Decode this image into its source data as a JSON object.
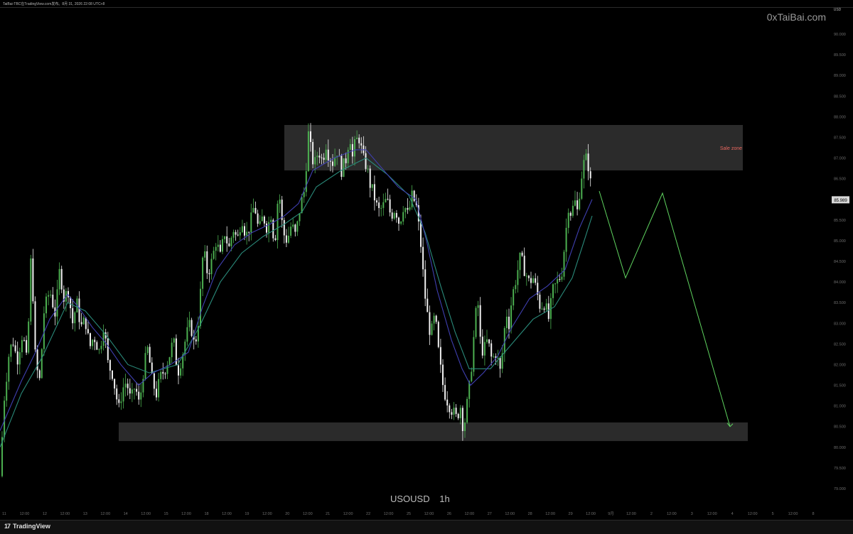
{
  "header": {
    "author_line": "TaiBai-TBC在TradingView.com发布。8月 31, 2026 22:08 UTC+8"
  },
  "watermark": "0xTaiBai.com",
  "symbol": "USOUSD",
  "interval": "1h",
  "footer": {
    "brand": "TradingView",
    "brand_mark": "17"
  },
  "colors": {
    "background": "#000000",
    "candle_up": "#4caf50",
    "candle_down": "#f0f0f0",
    "ma_fast": "#3f3fb0",
    "ma_slow": "#2a8a7a",
    "projection": "#5fd35f",
    "zone_fill": "#2b2b2b",
    "zone_label": "#e8675f"
  },
  "chart_data": {
    "type": "candlestick",
    "timeframe": "1h",
    "y_axis_label": "USD",
    "ylim": [
      79.0,
      90.3
    ],
    "y_ticks": [
      "79.000",
      "79.500",
      "80.000",
      "80.500",
      "81.000",
      "81.500",
      "82.000",
      "82.500",
      "83.000",
      "83.500",
      "84.000",
      "84.500",
      "85.000",
      "85.500",
      "86.000",
      "86.500",
      "87.000",
      "87.500",
      "88.000",
      "88.500",
      "89.000",
      "89.500",
      "90.000"
    ],
    "last_price": "85.989",
    "x_ticks": [
      "11",
      "12:00",
      "12",
      "12:00",
      "13",
      "12:00",
      "14",
      "12:00",
      "15",
      "12:00",
      "18",
      "12:00",
      "19",
      "12:00",
      "20",
      "12:00",
      "21",
      "12:00",
      "22",
      "12:00",
      "25",
      "12:00",
      "26",
      "12:00",
      "27",
      "12:00",
      "28",
      "12:00",
      "29",
      "12:00",
      "9月",
      "12:00",
      "2",
      "12:00",
      "3",
      "12:00",
      "4",
      "12:00",
      "5",
      "12:00",
      "8",
      "12:00"
    ],
    "price_path": [
      [
        0,
        79.3
      ],
      [
        6,
        81.2
      ],
      [
        12,
        82.2
      ],
      [
        18,
        82.6
      ],
      [
        24,
        82.1
      ],
      [
        32,
        82.8
      ],
      [
        38,
        82.0
      ],
      [
        44,
        84.8
      ],
      [
        50,
        82.0
      ],
      [
        56,
        81.6
      ],
      [
        62,
        83.3
      ],
      [
        70,
        83.8
      ],
      [
        78,
        83.2
      ],
      [
        84,
        84.3
      ],
      [
        90,
        83.6
      ],
      [
        96,
        83.8
      ],
      [
        102,
        83.0
      ],
      [
        108,
        83.5
      ],
      [
        114,
        82.9
      ],
      [
        120,
        83.1
      ],
      [
        126,
        82.4
      ],
      [
        132,
        82.7
      ],
      [
        140,
        82.3
      ],
      [
        146,
        83.0
      ],
      [
        152,
        82.0
      ],
      [
        158,
        81.8
      ],
      [
        163,
        81.3
      ],
      [
        167,
        80.9
      ],
      [
        172,
        81.4
      ],
      [
        178,
        81.6
      ],
      [
        184,
        81.1
      ],
      [
        190,
        81.5
      ],
      [
        196,
        81.0
      ],
      [
        202,
        81.9
      ],
      [
        208,
        82.4
      ],
      [
        214,
        81.6
      ],
      [
        220,
        81.3
      ],
      [
        226,
        81.7
      ],
      [
        232,
        81.9
      ],
      [
        238,
        82.2
      ],
      [
        244,
        82.6
      ],
      [
        250,
        81.8
      ],
      [
        256,
        82.2
      ],
      [
        262,
        82.7
      ],
      [
        268,
        83.0
      ],
      [
        274,
        82.4
      ],
      [
        280,
        83.2
      ],
      [
        286,
        84.8
      ],
      [
        292,
        84.2
      ],
      [
        298,
        84.5
      ],
      [
        304,
        85.0
      ],
      [
        310,
        84.6
      ],
      [
        316,
        85.2
      ],
      [
        322,
        84.8
      ],
      [
        328,
        85.3
      ],
      [
        334,
        85.0
      ],
      [
        340,
        85.6
      ],
      [
        346,
        85.1
      ],
      [
        352,
        85.4
      ],
      [
        358,
        85.9
      ],
      [
        364,
        85.2
      ],
      [
        370,
        85.6
      ],
      [
        376,
        85.3
      ],
      [
        382,
        85.7
      ],
      [
        386,
        84.8
      ],
      [
        392,
        86.3
      ],
      [
        398,
        85.2
      ],
      [
        404,
        85.0
      ],
      [
        410,
        85.4
      ],
      [
        416,
        85.1
      ],
      [
        422,
        85.8
      ],
      [
        428,
        86.2
      ],
      [
        434,
        87.6
      ],
      [
        438,
        87.1
      ],
      [
        442,
        86.8
      ],
      [
        448,
        87.2
      ],
      [
        454,
        86.9
      ],
      [
        458,
        87.4
      ],
      [
        462,
        87.1
      ],
      [
        468,
        86.9
      ],
      [
        474,
        87.2
      ],
      [
        480,
        86.7
      ],
      [
        486,
        86.9
      ],
      [
        492,
        87.6
      ],
      [
        496,
        87.0
      ],
      [
        500,
        87.4
      ],
      [
        506,
        87.5
      ],
      [
        510,
        87.0
      ],
      [
        516,
        86.8
      ],
      [
        520,
        86.4
      ],
      [
        526,
        86.1
      ],
      [
        532,
        85.7
      ],
      [
        538,
        85.8
      ],
      [
        544,
        86.0
      ],
      [
        550,
        85.6
      ],
      [
        556,
        85.8
      ],
      [
        562,
        85.4
      ],
      [
        568,
        85.9
      ],
      [
        574,
        85.6
      ],
      [
        580,
        86.1
      ],
      [
        586,
        85.8
      ],
      [
        592,
        84.9
      ],
      [
        597,
        83.8
      ],
      [
        602,
        83.1
      ],
      [
        606,
        82.7
      ],
      [
        612,
        83.2
      ],
      [
        618,
        82.1
      ],
      [
        624,
        81.4
      ],
      [
        630,
        81.1
      ],
      [
        636,
        80.9
      ],
      [
        642,
        80.7
      ],
      [
        648,
        81.0
      ],
      [
        652,
        80.4
      ],
      [
        656,
        80.9
      ],
      [
        660,
        81.4
      ],
      [
        664,
        82.1
      ],
      [
        668,
        83.0
      ],
      [
        672,
        83.6
      ],
      [
        676,
        82.5
      ],
      [
        680,
        82.3
      ],
      [
        686,
        82.6
      ],
      [
        692,
        82.1
      ],
      [
        698,
        82.3
      ],
      [
        704,
        81.8
      ],
      [
        708,
        82.5
      ],
      [
        712,
        83.3
      ],
      [
        716,
        83.0
      ],
      [
        720,
        83.6
      ],
      [
        726,
        84.1
      ],
      [
        732,
        84.6
      ],
      [
        738,
        84.3
      ],
      [
        744,
        84.0
      ],
      [
        750,
        84.1
      ],
      [
        756,
        83.7
      ],
      [
        760,
        83.4
      ],
      [
        766,
        83.5
      ],
      [
        772,
        83.1
      ],
      [
        778,
        83.8
      ],
      [
        784,
        84.0
      ],
      [
        790,
        84.2
      ],
      [
        796,
        85.2
      ],
      [
        800,
        85.9
      ],
      [
        804,
        85.6
      ],
      [
        808,
        86.0
      ],
      [
        812,
        85.7
      ],
      [
        816,
        86.3
      ],
      [
        820,
        86.8
      ],
      [
        824,
        87.0
      ],
      [
        828,
        86.8
      ],
      [
        832,
        86.2
      ]
    ],
    "ma_fast_path": [
      [
        0,
        80.4
      ],
      [
        30,
        81.6
      ],
      [
        50,
        82.3
      ],
      [
        70,
        83.1
      ],
      [
        95,
        83.7
      ],
      [
        110,
        83.4
      ],
      [
        130,
        82.9
      ],
      [
        150,
        82.5
      ],
      [
        170,
        82.0
      ],
      [
        195,
        81.5
      ],
      [
        215,
        81.8
      ],
      [
        240,
        82.0
      ],
      [
        265,
        82.3
      ],
      [
        285,
        83.4
      ],
      [
        305,
        84.3
      ],
      [
        330,
        84.9
      ],
      [
        355,
        85.2
      ],
      [
        380,
        85.4
      ],
      [
        400,
        85.6
      ],
      [
        420,
        85.9
      ],
      [
        440,
        86.7
      ],
      [
        470,
        87.0
      ],
      [
        500,
        87.2
      ],
      [
        515,
        87.2
      ],
      [
        535,
        86.8
      ],
      [
        560,
        86.3
      ],
      [
        585,
        86.0
      ],
      [
        600,
        85.0
      ],
      [
        615,
        83.8
      ],
      [
        635,
        82.6
      ],
      [
        650,
        81.9
      ],
      [
        662,
        81.5
      ],
      [
        680,
        81.8
      ],
      [
        700,
        82.2
      ],
      [
        720,
        82.9
      ],
      [
        745,
        83.6
      ],
      [
        770,
        83.9
      ],
      [
        795,
        84.3
      ],
      [
        815,
        85.3
      ],
      [
        833,
        86.0
      ]
    ],
    "ma_slow_path": [
      [
        0,
        80.0
      ],
      [
        30,
        81.3
      ],
      [
        60,
        82.2
      ],
      [
        95,
        83.5
      ],
      [
        120,
        83.3
      ],
      [
        150,
        82.7
      ],
      [
        180,
        82.0
      ],
      [
        210,
        81.8
      ],
      [
        250,
        82.0
      ],
      [
        280,
        82.9
      ],
      [
        310,
        84.0
      ],
      [
        340,
        84.7
      ],
      [
        370,
        85.1
      ],
      [
        400,
        85.4
      ],
      [
        425,
        85.7
      ],
      [
        445,
        86.3
      ],
      [
        480,
        86.7
      ],
      [
        515,
        87.0
      ],
      [
        545,
        86.6
      ],
      [
        575,
        86.1
      ],
      [
        598,
        85.2
      ],
      [
        620,
        83.9
      ],
      [
        640,
        82.8
      ],
      [
        660,
        81.9
      ],
      [
        690,
        81.9
      ],
      [
        720,
        82.5
      ],
      [
        750,
        83.1
      ],
      [
        780,
        83.4
      ],
      [
        805,
        84.1
      ],
      [
        820,
        84.9
      ],
      [
        833,
        85.6
      ]
    ],
    "zones": [
      {
        "name": "Sale zone",
        "label": "Sale zone",
        "price_top": 87.8,
        "price_bottom": 86.7
      },
      {
        "name": "support zone",
        "label": "",
        "price_top": 80.6,
        "price_bottom": 80.15
      }
    ],
    "projection_path": [
      [
        843,
        86.2
      ],
      [
        880,
        84.1
      ],
      [
        932,
        86.15
      ],
      [
        1027,
        80.5
      ]
    ],
    "grid": false
  }
}
